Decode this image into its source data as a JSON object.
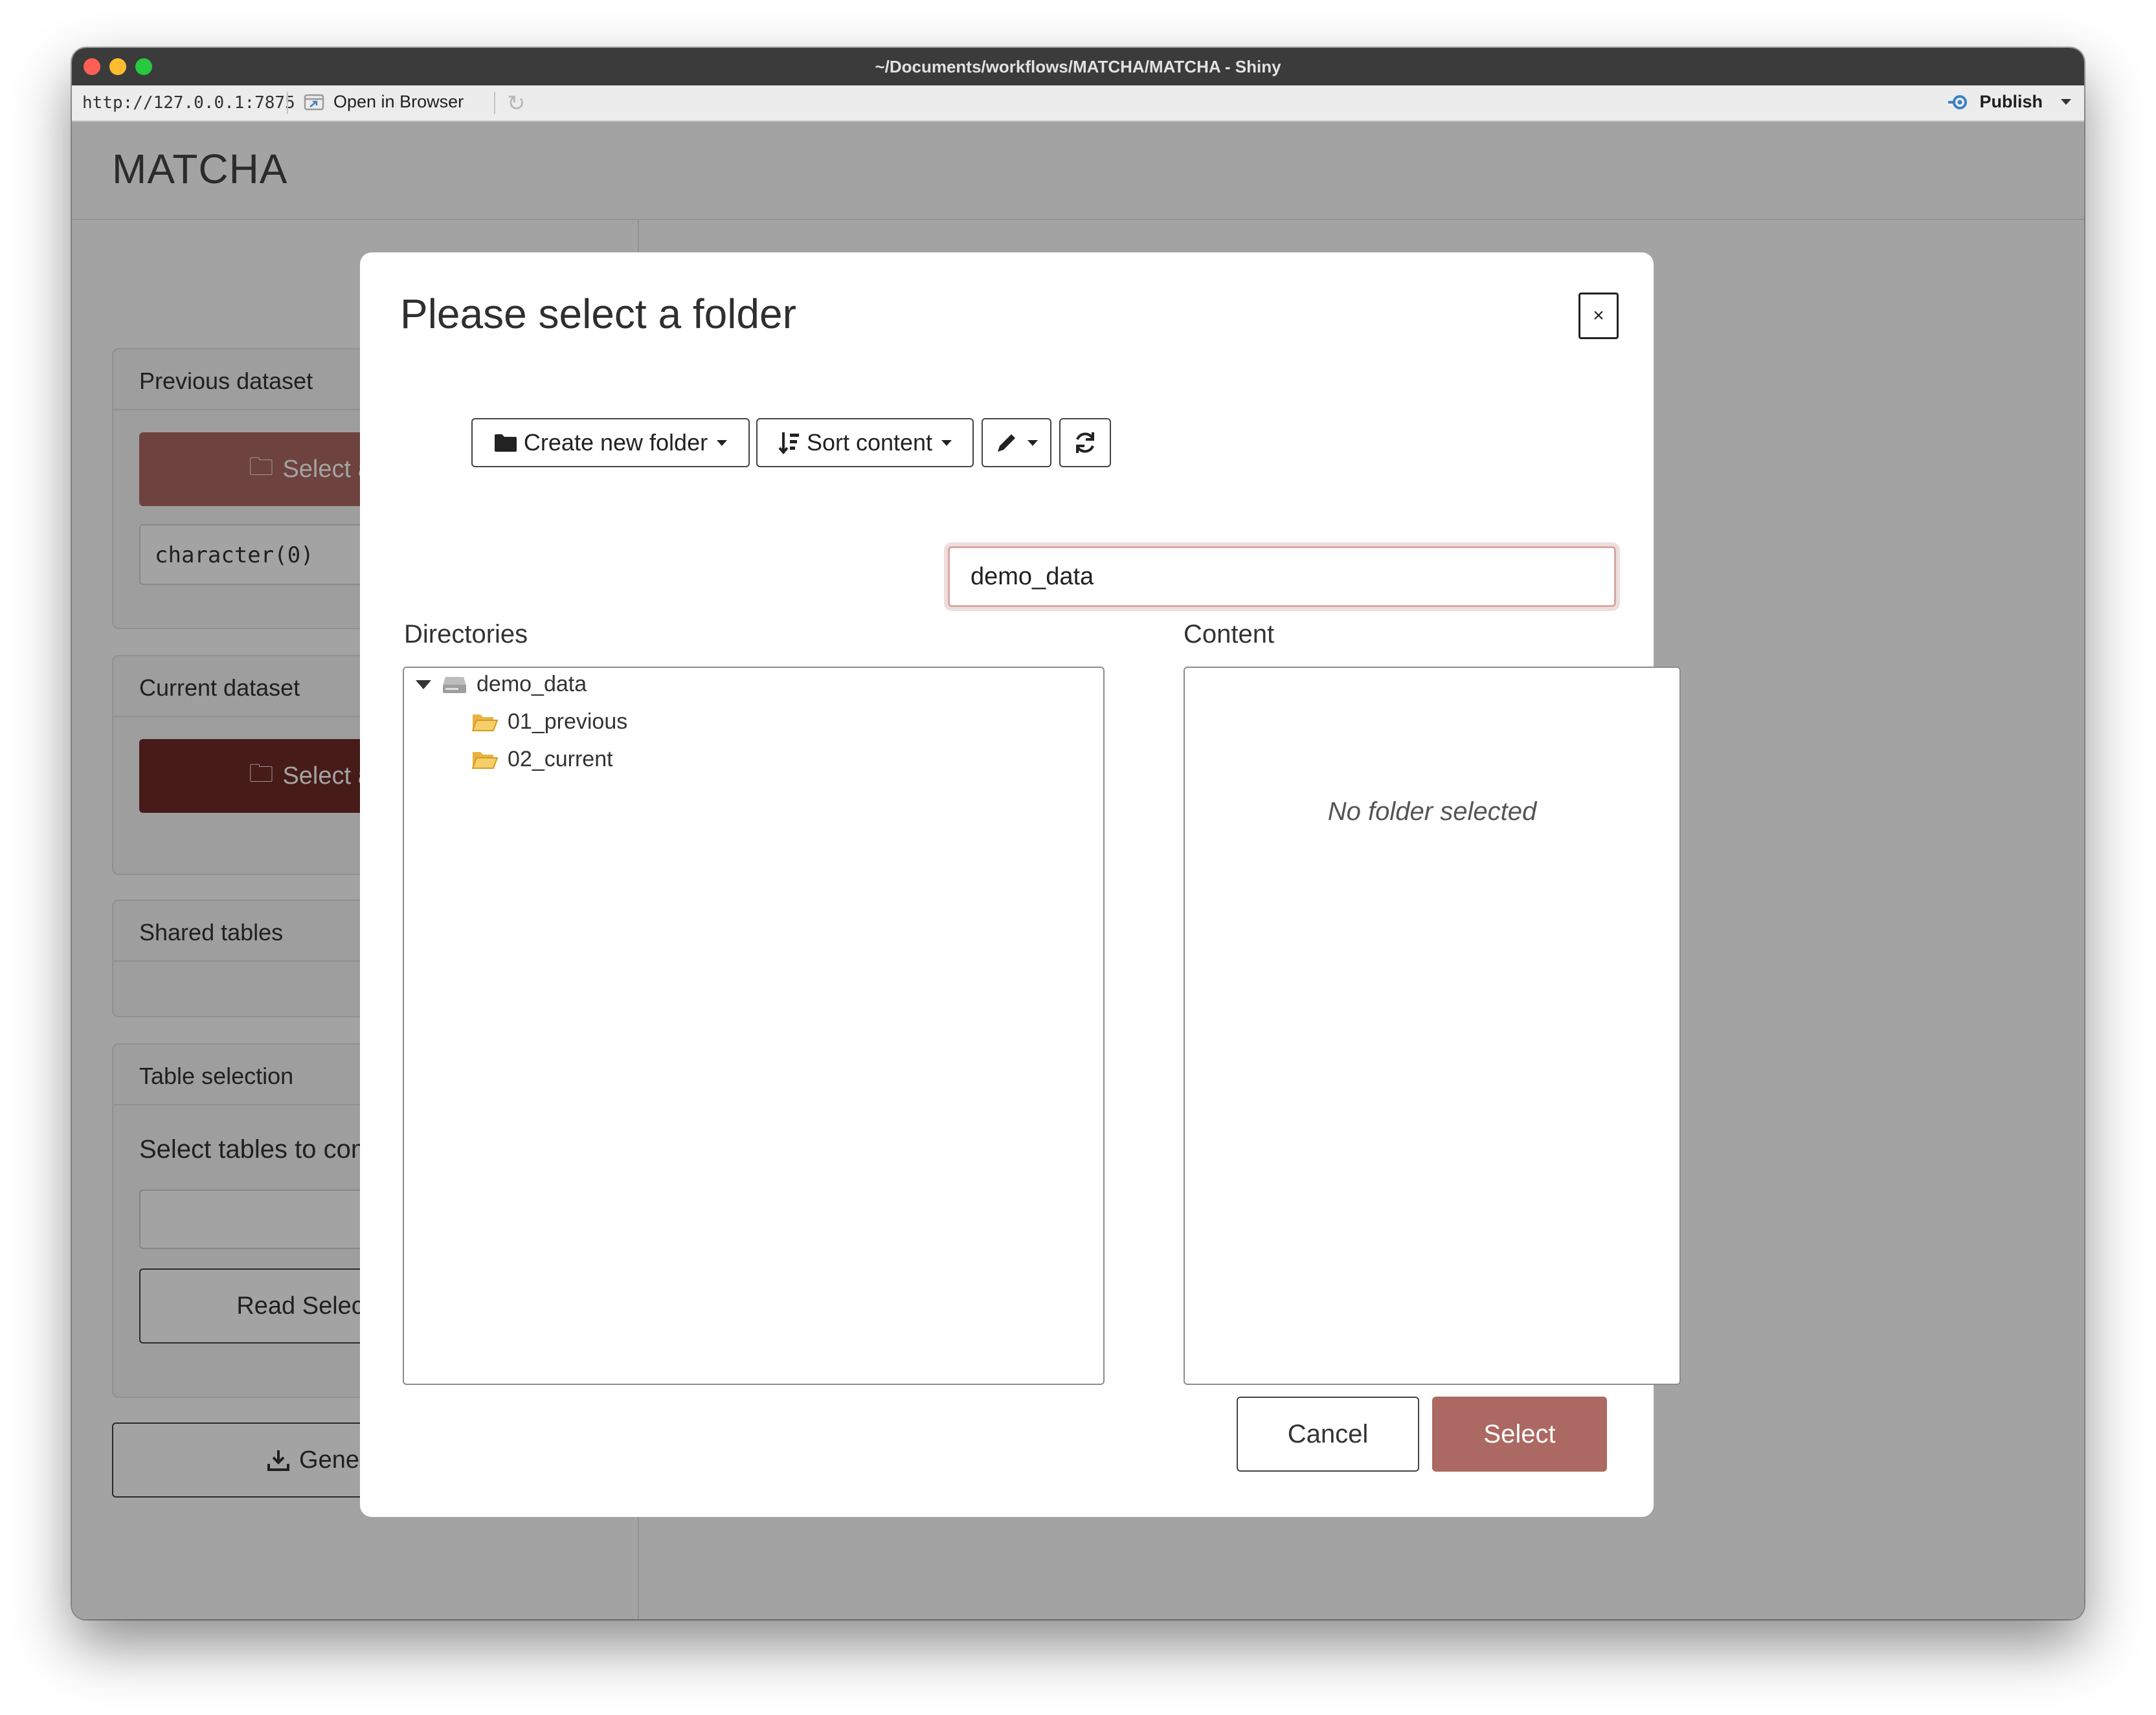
{
  "window": {
    "title": "~/Documents/workflows/MATCHA/MATCHA - Shiny"
  },
  "toolbar": {
    "url": "http://127.0.0.1:7875",
    "open_in_browser": "Open in Browser",
    "publish": "Publish"
  },
  "app": {
    "title": "MATCHA",
    "sidebar": {
      "previous_dataset": {
        "header": "Previous dataset",
        "button": "Select a fold",
        "value": "character(0)"
      },
      "current_dataset": {
        "header": "Current dataset",
        "button": "Select a fold"
      },
      "shared_tables": {
        "header": "Shared tables"
      },
      "table_selection": {
        "header": "Table selection",
        "label": "Select tables to compa",
        "read_button": "Read Selected Ta"
      },
      "generate_button": "Generate rep"
    }
  },
  "modal": {
    "title": "Please select a folder",
    "close": "×",
    "toolbar": {
      "create_folder": "Create new folder",
      "sort_content": "Sort content"
    },
    "folder_name_value": "demo_data",
    "directories_label": "Directories",
    "content_label": "Content",
    "tree": {
      "root": "demo_data",
      "children": [
        "01_previous",
        "02_current"
      ]
    },
    "content_empty": "No folder selected",
    "cancel": "Cancel",
    "select": "Select"
  },
  "colors": {
    "accent": "#ac6862",
    "accent_dark": "#6e2b27",
    "titlebar": "#3b3b3b"
  }
}
